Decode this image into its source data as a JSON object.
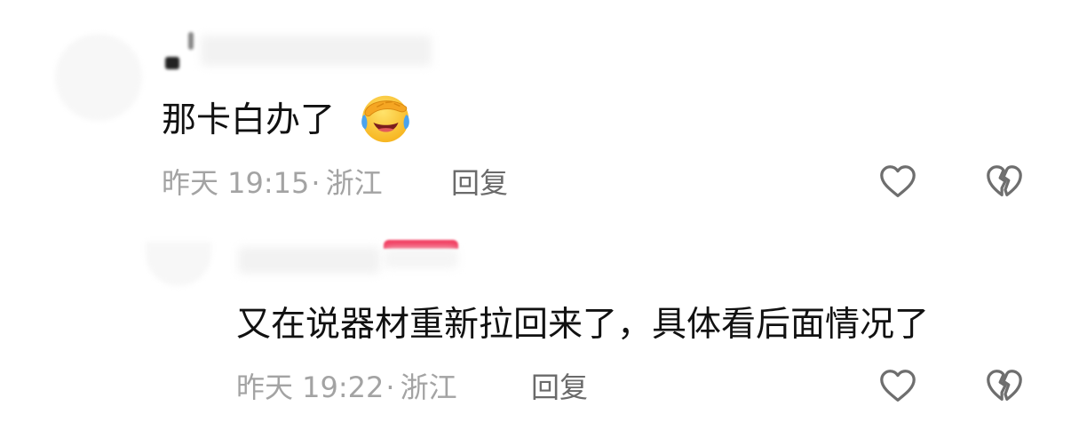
{
  "comments": [
    {
      "text": "那卡白办了",
      "emoji": "face-palm-crying-emoji",
      "time": "昨天 19:15",
      "separator": "·",
      "location": "浙江",
      "reply_label": "回复",
      "like_icon": "heart-outline-icon",
      "dislike_icon": "broken-heart-outline-icon"
    },
    {
      "text": "又在说器材重新拉回来了，具体看后面情况了",
      "time": "昨天 19:22",
      "separator": "·",
      "location": "浙江",
      "reply_label": "回复",
      "like_icon": "heart-outline-icon",
      "dislike_icon": "broken-heart-outline-icon"
    }
  ],
  "colors": {
    "text": "#111111",
    "meta": "#a3a3a3",
    "reply": "#6a6a6a",
    "icon": "#6e6e6e",
    "badge": "#f23b5f"
  }
}
